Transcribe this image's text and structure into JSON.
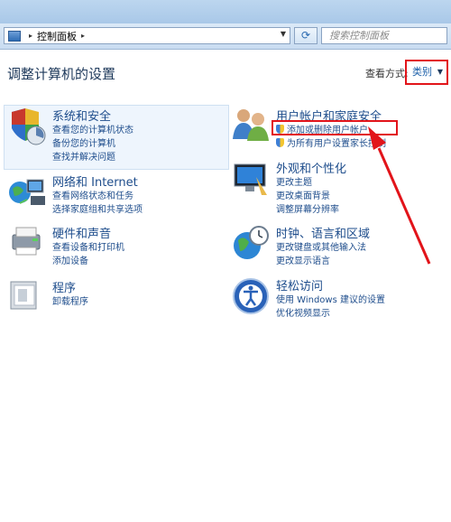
{
  "address": {
    "path_root": "▸",
    "location": "控制面板",
    "trail_arrow": "▸",
    "search_placeholder": "搜索控制面板"
  },
  "page": {
    "heading": "调整计算机的设置"
  },
  "view": {
    "label": "查看方式:",
    "selected": "类别"
  },
  "categories": [
    {
      "title": "系统和安全",
      "links": [
        "查看您的计算机状态",
        "备份您的计算机",
        "查找并解决问题"
      ]
    },
    {
      "title": "网络和 Internet",
      "links": [
        "查看网络状态和任务",
        "选择家庭组和共享选项"
      ]
    },
    {
      "title": "硬件和声音",
      "links": [
        "查看设备和打印机",
        "添加设备"
      ]
    },
    {
      "title": "程序",
      "links": [
        "卸载程序"
      ]
    },
    {
      "title": "用户帐户和家庭安全",
      "links": [
        "添加或删除用户帐户",
        "为所有用户设置家长控制"
      ]
    },
    {
      "title": "外观和个性化",
      "links": [
        "更改主题",
        "更改桌面背景",
        "调整屏幕分辨率"
      ]
    },
    {
      "title": "时钟、语言和区域",
      "links": [
        "更改键盘或其他输入法",
        "更改显示语言"
      ]
    },
    {
      "title": "轻松访问",
      "links": [
        "使用 Windows 建议的设置",
        "优化视频显示"
      ]
    }
  ],
  "colors": {
    "link": "#1e4d8c",
    "heading": "#1e395b",
    "highlight": "#e2141a"
  },
  "icons": [
    "control-panel-icon",
    "refresh-icon",
    "system-security-icon",
    "network-icon",
    "hardware-sound-icon",
    "programs-icon",
    "user-accounts-icon",
    "appearance-icon",
    "clock-globe-icon",
    "ease-of-access-icon",
    "shield-icon"
  ]
}
